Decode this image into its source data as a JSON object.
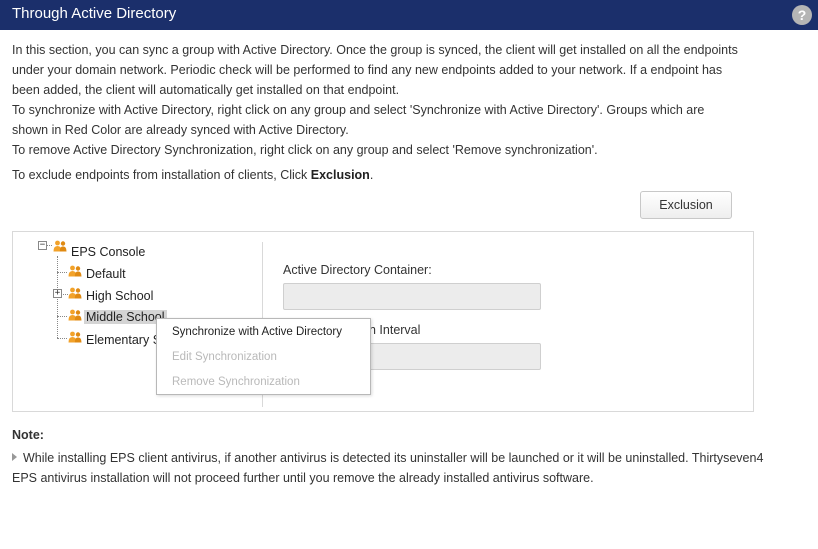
{
  "header": {
    "title": "Through Active Directory",
    "help_icon": "question-mark-icon",
    "help_glyph": "?"
  },
  "intro": {
    "lines": [
      "In this section, you can sync a group with Active Directory. Once the group is synced, the client will get installed on all the endpoints",
      "under your domain network. Periodic check will be performed to find any new endpoints added to your network. If a endpoint has",
      "been added, the client will automatically get installed on that endpoint.",
      "To synchronize with Active Directory, right click on any group and select 'Synchronize with Active Directory'. Groups which are",
      "shown in Red Color are already synced with Active Directory.",
      "To remove Active Directory Synchronization, right click on any group and select 'Remove synchronization'."
    ],
    "exclude_prefix": "To exclude endpoints from installation of clients, Click ",
    "exclude_bold": "Exclusion",
    "exclude_suffix": "."
  },
  "exclusion_button": {
    "label": "Exclusion"
  },
  "tree": {
    "root": {
      "label": "EPS Console",
      "toggle": "−",
      "icon": "group-icon"
    },
    "children": [
      {
        "label": "Default",
        "icon": "group-icon"
      },
      {
        "label": "High School",
        "icon": "group-icon",
        "toggle": "+"
      },
      {
        "label": "Middle School",
        "icon": "group-icon",
        "selected": true
      },
      {
        "label": "Elementary S",
        "icon": "group-icon"
      }
    ]
  },
  "right_panel": {
    "container_label": "Active Directory Container:",
    "container_value": "",
    "interval_label": "n Interval",
    "interval_value": ""
  },
  "context_menu": {
    "items": [
      {
        "label": "Synchronize with Active Directory",
        "enabled": true
      },
      {
        "label": "Edit Synchronization",
        "enabled": false
      },
      {
        "label": "Remove Synchronization",
        "enabled": false
      }
    ]
  },
  "note": {
    "title": "Note:",
    "line1": "While installing EPS client antivirus, if another antivirus is detected its uninstaller will be launched or it will be uninstalled. Thirtyseven4",
    "line2": "EPS antivirus installation will not proceed further until you remove the already installed antivirus software."
  },
  "colors": {
    "header_bg": "#1b2f6b",
    "group_icon": "#f2a22a",
    "disabled_text": "#b9b9b9"
  }
}
